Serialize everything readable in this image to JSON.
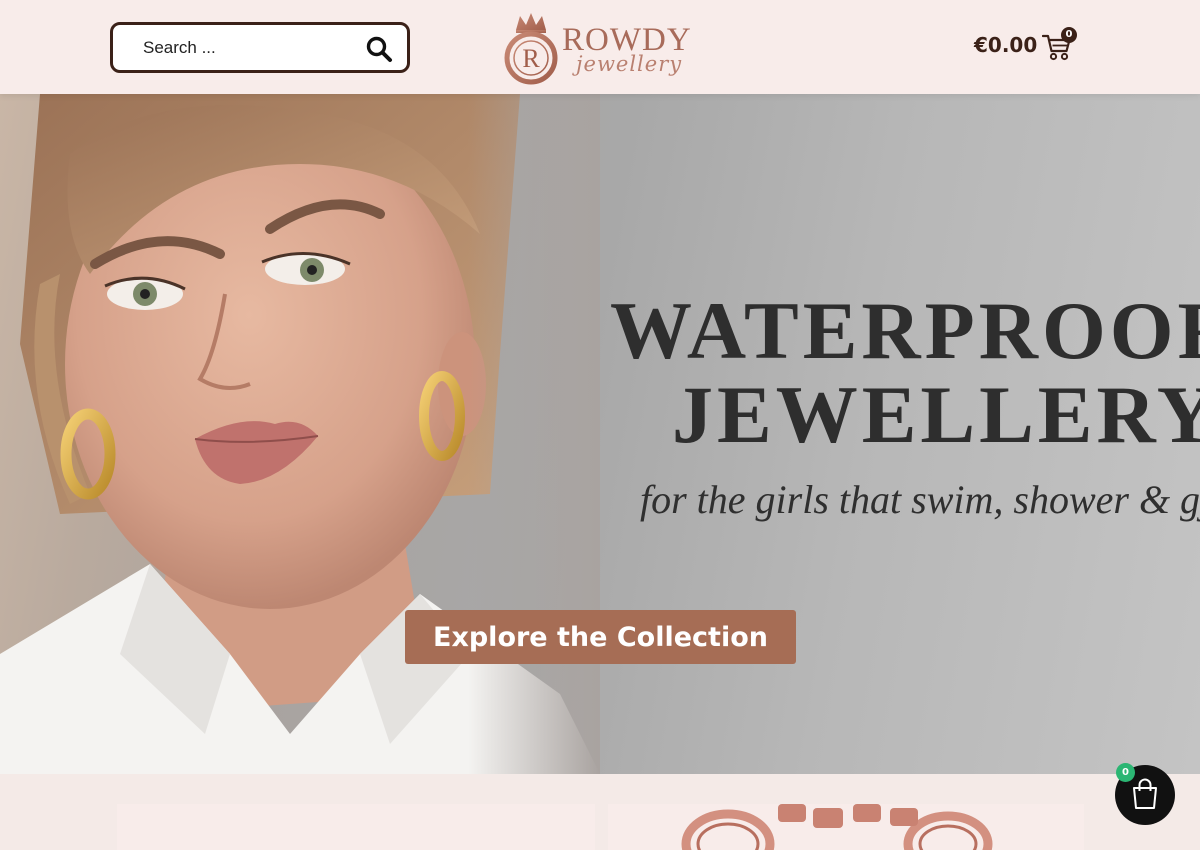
{
  "header": {
    "search": {
      "placeholder": "Search ..."
    },
    "logo": {
      "brand": "ROWDY",
      "script": "jewellery",
      "monogram": "R"
    },
    "cart": {
      "total": "€0.00",
      "count": "0"
    }
  },
  "hero": {
    "title_line1": "WATERPROOF",
    "title_line2": "JEWELLERY",
    "subtitle": "for the girls that swim, shower & gym",
    "cta_label": "Explore the Collection"
  },
  "floating_cart": {
    "count": "0"
  },
  "icons": [
    "search-icon",
    "cart-icon",
    "shopping-bag-icon",
    "crown-icon"
  ],
  "colors": {
    "accent": "#a66d55",
    "dark": "#3b2118",
    "header_bg": "#f8ecea",
    "badge_green": "#2bb673"
  }
}
